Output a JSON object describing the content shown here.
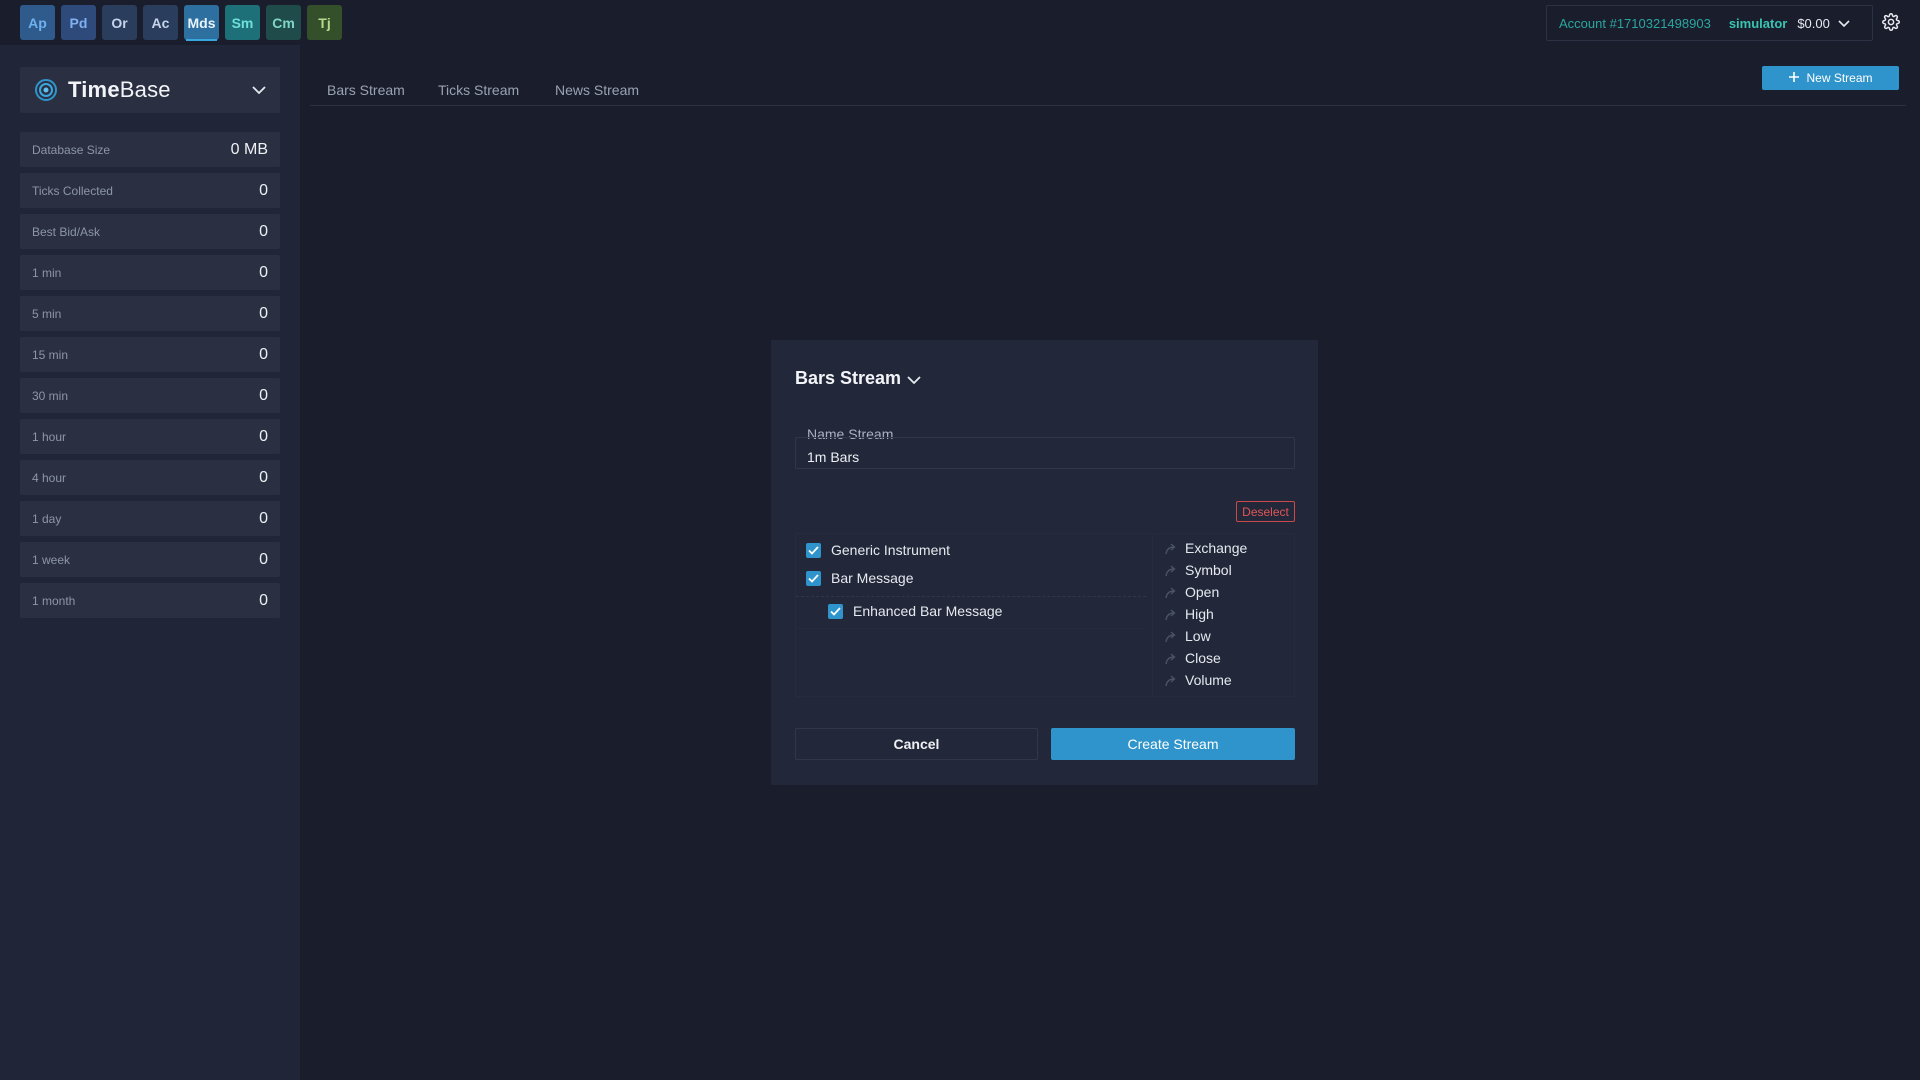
{
  "app_tabs": [
    {
      "label": "Ap",
      "bg": "#2e5a8c",
      "fg": "#6fb1ef"
    },
    {
      "label": "Pd",
      "bg": "#2e4a7a",
      "fg": "#7fb0f0"
    },
    {
      "label": "Or",
      "bg": "#2b3d5c",
      "fg": "#c5d4ea"
    },
    {
      "label": "Ac",
      "bg": "#2b3d5c",
      "fg": "#c5d4ea"
    },
    {
      "label": "Mds",
      "bg": "#2d6f9e",
      "fg": "#e8f3fb",
      "active": true
    },
    {
      "label": "Sm",
      "bg": "#1d7078",
      "fg": "#6fe0d8"
    },
    {
      "label": "Cm",
      "bg": "#1f4b4a",
      "fg": "#7fd6c8"
    },
    {
      "label": "Tj",
      "bg": "#34502a",
      "fg": "#b9d98c"
    }
  ],
  "account": {
    "number": "Account #1710321498903",
    "mode": "simulator",
    "balance": "$0.00"
  },
  "sidebar": {
    "brand": {
      "bold": "Time",
      "light": "Base"
    },
    "stats": [
      {
        "label": "Database Size",
        "value": "0 MB"
      },
      {
        "label": "Ticks Collected",
        "value": "0"
      },
      {
        "label": "Best Bid/Ask",
        "value": "0"
      },
      {
        "label": "1 min",
        "value": "0"
      },
      {
        "label": "5 min",
        "value": "0"
      },
      {
        "label": "15 min",
        "value": "0"
      },
      {
        "label": "30 min",
        "value": "0"
      },
      {
        "label": "1 hour",
        "value": "0"
      },
      {
        "label": "4 hour",
        "value": "0"
      },
      {
        "label": "1 day",
        "value": "0"
      },
      {
        "label": "1 week",
        "value": "0"
      },
      {
        "label": "1 month",
        "value": "0"
      }
    ]
  },
  "main": {
    "tabs": [
      "Bars Stream",
      "Ticks Stream",
      "News Stream"
    ],
    "new_stream_label": "New Stream"
  },
  "dialog": {
    "title": "Bars Stream",
    "name_label": "Name Stream",
    "name_value": "1m Bars",
    "deselect_label": "Deselect",
    "messages": [
      {
        "label": "Generic Instrument",
        "checked": true
      },
      {
        "label": "Bar Message",
        "checked": true
      },
      {
        "label": "Enhanced Bar Message",
        "checked": true
      }
    ],
    "fields": [
      "Exchange",
      "Symbol",
      "Open",
      "High",
      "Low",
      "Close",
      "Volume"
    ],
    "cancel_label": "Cancel",
    "create_label": "Create Stream"
  }
}
